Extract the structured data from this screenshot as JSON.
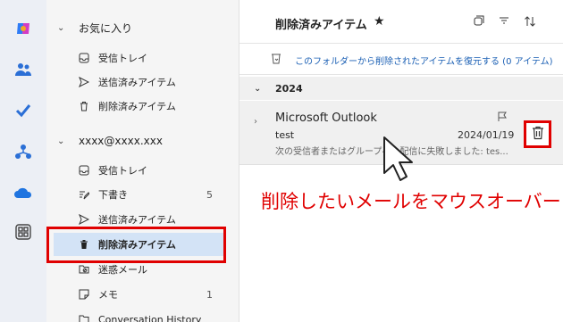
{
  "favorites": {
    "title": "お気に入り",
    "items": [
      {
        "label": "受信トレイ",
        "icon": "inbox-icon"
      },
      {
        "label": "送信済みアイテム",
        "icon": "send-icon"
      },
      {
        "label": "削除済みアイテム",
        "icon": "trash-icon"
      }
    ]
  },
  "account": {
    "title": "xxxx@xxxx.xxx",
    "items": [
      {
        "label": "受信トレイ",
        "icon": "inbox-icon",
        "count": ""
      },
      {
        "label": "下書き",
        "icon": "draft-icon",
        "count": "5"
      },
      {
        "label": "送信済みアイテム",
        "icon": "send-icon",
        "count": ""
      },
      {
        "label": "削除済みアイテム",
        "icon": "trash-icon",
        "count": "",
        "selected": true
      },
      {
        "label": "迷惑メール",
        "icon": "junk-icon",
        "count": ""
      },
      {
        "label": "メモ",
        "icon": "note-icon",
        "count": "1"
      },
      {
        "label": "Conversation History",
        "icon": "folder-icon",
        "count": ""
      }
    ]
  },
  "list": {
    "title": "削除済みアイテム",
    "restore_text": "このフォルダーから削除されたアイテムを復元する (0 アイテム)",
    "section": "2024",
    "message": {
      "sender": "Microsoft Outlook",
      "subject": "test",
      "date": "2024/01/19",
      "preview": "次の受信者またはグループへの配信に失敗しました: tes..."
    }
  },
  "annotation": "削除したいメールをマウスオーバー",
  "colors": {
    "highlight": "#e00000",
    "selected": "#d3e3f6",
    "link": "#1a5fb4"
  }
}
